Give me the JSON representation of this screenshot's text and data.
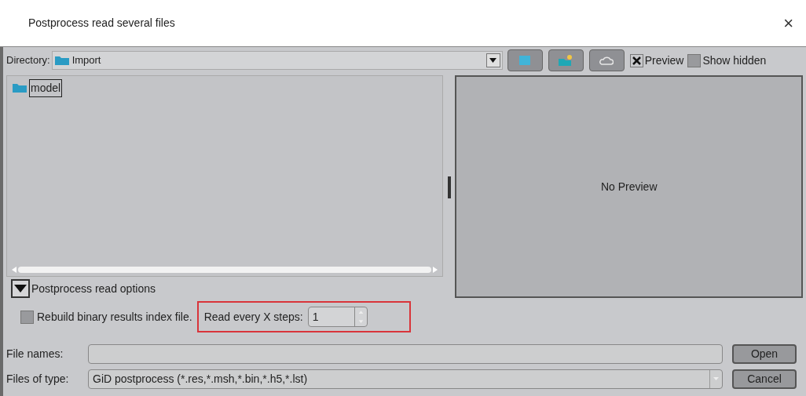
{
  "window": {
    "title": "Postprocess read several files",
    "close": "×"
  },
  "directory": {
    "label": "Directory:",
    "value": "Import"
  },
  "toolbar": {
    "preview": {
      "label": "Preview",
      "checked": true
    },
    "show_hidden": {
      "label": "Show hidden",
      "checked": false
    }
  },
  "files": [
    {
      "name": "model",
      "selected": true
    }
  ],
  "preview": {
    "text": "No Preview"
  },
  "options": {
    "title": "Postprocess read options",
    "expanded": true,
    "rebuild": {
      "label": "Rebuild binary results index file.",
      "checked": false
    },
    "read_every": {
      "label": "Read every X steps:",
      "value": "1"
    }
  },
  "file_names": {
    "label": "File names:"
  },
  "files_of_type": {
    "label": "Files of type:",
    "value": "GiD postprocess (*.res,*.msh,*.bin,*.h5,*.lst)"
  },
  "buttons": [
    {
      "label": "Open"
    },
    {
      "label": "Cancel"
    }
  ]
}
